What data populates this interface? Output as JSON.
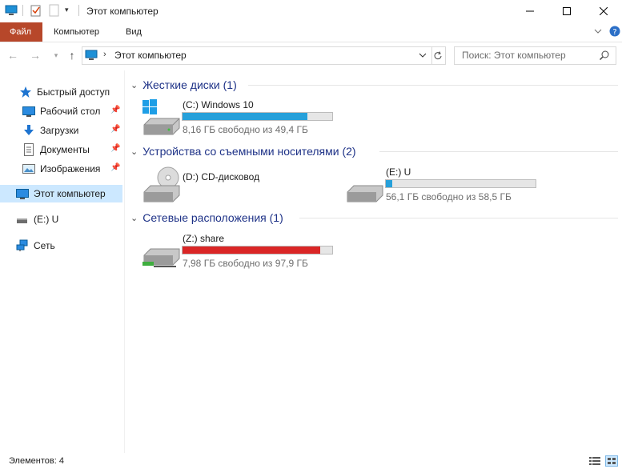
{
  "window": {
    "title": "Этот компьютер"
  },
  "ribbon": {
    "tabs": [
      "Файл",
      "Компьютер",
      "Вид"
    ]
  },
  "address": {
    "path": "Этот компьютер",
    "search_placeholder": "Поиск: Этот компьютер"
  },
  "navpane": {
    "quick_access": "Быстрый доступ",
    "desktop": "Рабочий стол",
    "downloads": "Загрузки",
    "documents": "Документы",
    "pictures": "Изображения",
    "this_pc": "Этот компьютер",
    "drive_e": "(E:) U",
    "network": "Сеть"
  },
  "groups": {
    "hard_drives": "Жесткие диски (1)",
    "removable": "Устройства со съемными носителями (2)",
    "network": "Сетевые расположения (1)"
  },
  "drives": {
    "c": {
      "name": "(C:) Windows 10",
      "free": "8,16 ГБ свободно из 49,4 ГБ",
      "used_fraction": 0.835,
      "color": "#26a0da"
    },
    "d": {
      "name": "(D:) CD-дисковод"
    },
    "e": {
      "name": "(E:) U",
      "free": "56,1 ГБ свободно из 58,5 ГБ",
      "used_fraction": 0.041,
      "color": "#26a0da"
    },
    "z": {
      "name": "(Z:) share",
      "free": "7,98 ГБ свободно из 97,9 ГБ",
      "used_fraction": 0.918,
      "color": "#da2626"
    }
  },
  "status": {
    "items": "Элементов: 4"
  }
}
